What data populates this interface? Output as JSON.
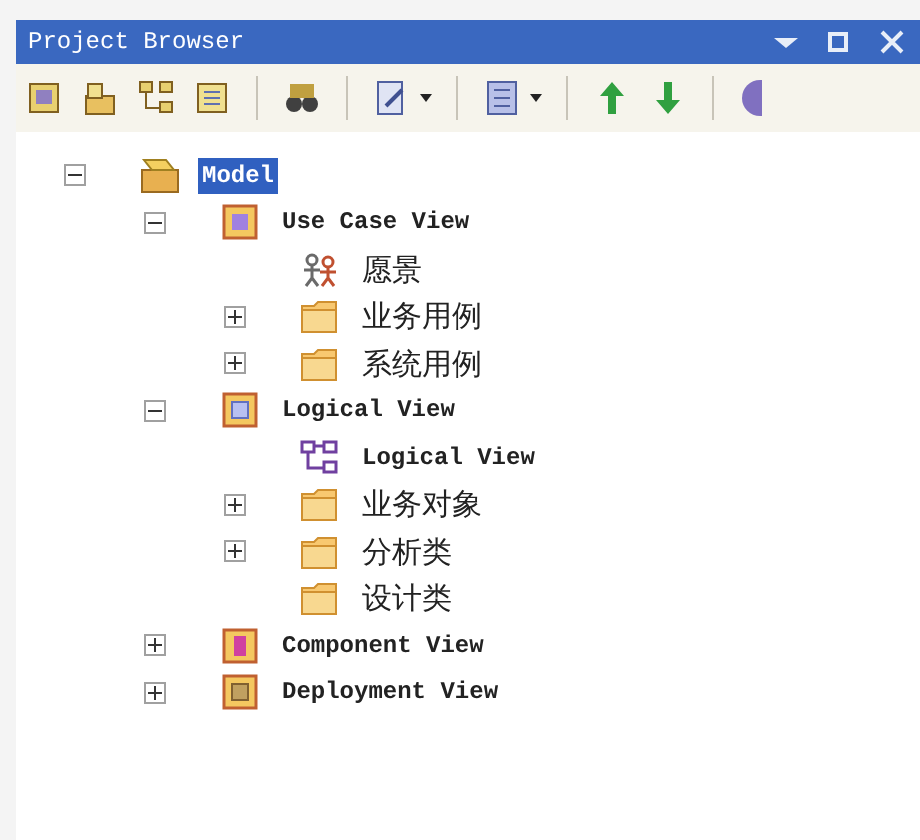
{
  "window": {
    "title": "Project Browser"
  },
  "tree": [
    {
      "label": "Model",
      "kind": "model",
      "expanded": true,
      "selected": true,
      "children": [
        {
          "label": "Use Case View",
          "kind": "usecase-package",
          "expanded": true,
          "selected": false,
          "children": [
            {
              "label": "愿景",
              "kind": "actor",
              "selected": false
            },
            {
              "label": "业务用例",
              "kind": "folder",
              "expanded": false,
              "selected": false
            },
            {
              "label": "系统用例",
              "kind": "folder",
              "expanded": false,
              "selected": false
            }
          ]
        },
        {
          "label": "Logical View",
          "kind": "logical-package",
          "expanded": true,
          "selected": false,
          "children": [
            {
              "label": "Logical View",
              "kind": "diagram",
              "selected": false
            },
            {
              "label": "业务对象",
              "kind": "folder",
              "expanded": false,
              "selected": false
            },
            {
              "label": "分析类",
              "kind": "folder",
              "expanded": false,
              "selected": false
            },
            {
              "label": "设计类",
              "kind": "folder",
              "selected": false
            }
          ]
        },
        {
          "label": "Component View",
          "kind": "component-package",
          "expanded": false,
          "selected": false
        },
        {
          "label": "Deployment View",
          "kind": "deployment-package",
          "expanded": false,
          "selected": false
        }
      ]
    }
  ]
}
